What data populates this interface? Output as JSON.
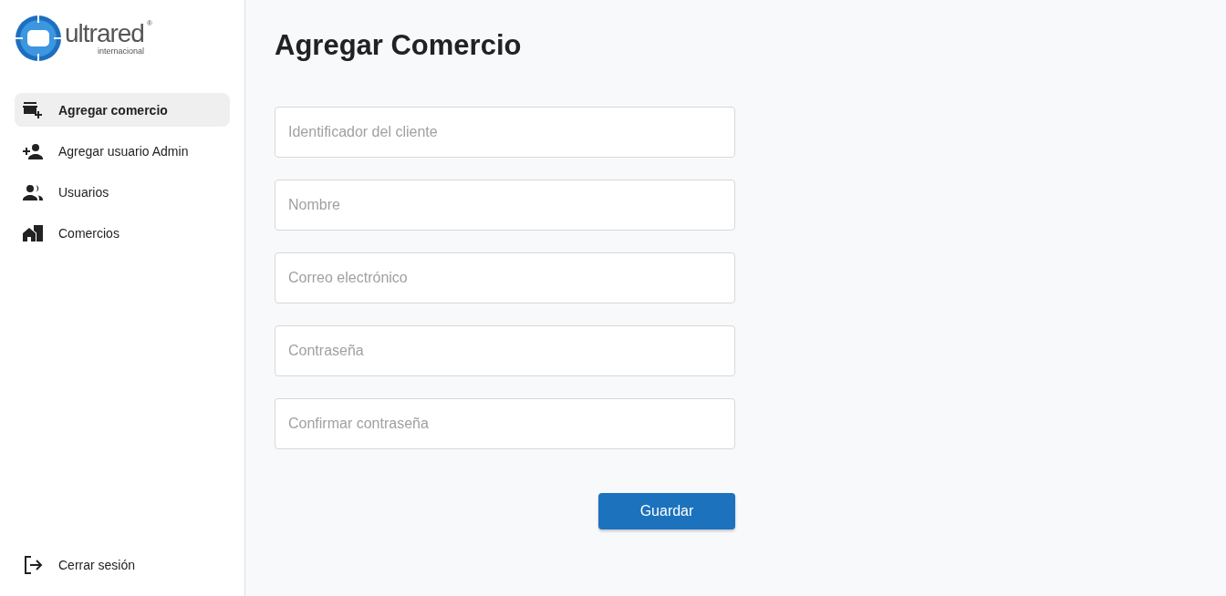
{
  "logo": {
    "name": "ultrared",
    "mark": "®",
    "subtitle": "internacional"
  },
  "nav": [
    {
      "label": "Agregar comercio",
      "kind": "store",
      "selected": true
    },
    {
      "label": "Agregar usuario Admin",
      "kind": "person-add",
      "selected": false
    },
    {
      "label": "Usuarios",
      "kind": "group",
      "selected": false
    },
    {
      "label": "Comercios",
      "kind": "building",
      "selected": false
    }
  ],
  "logout": {
    "label": "Cerrar sesión",
    "kind": "logout"
  },
  "title": "Agregar Comercio",
  "fields": [
    {
      "placeholder": "Identificador del cliente"
    },
    {
      "placeholder": "Nombre"
    },
    {
      "placeholder": "Correo electrónico"
    },
    {
      "placeholder": "Contraseña"
    },
    {
      "placeholder": "Confirmar contraseña"
    }
  ],
  "submit": "Guardar"
}
